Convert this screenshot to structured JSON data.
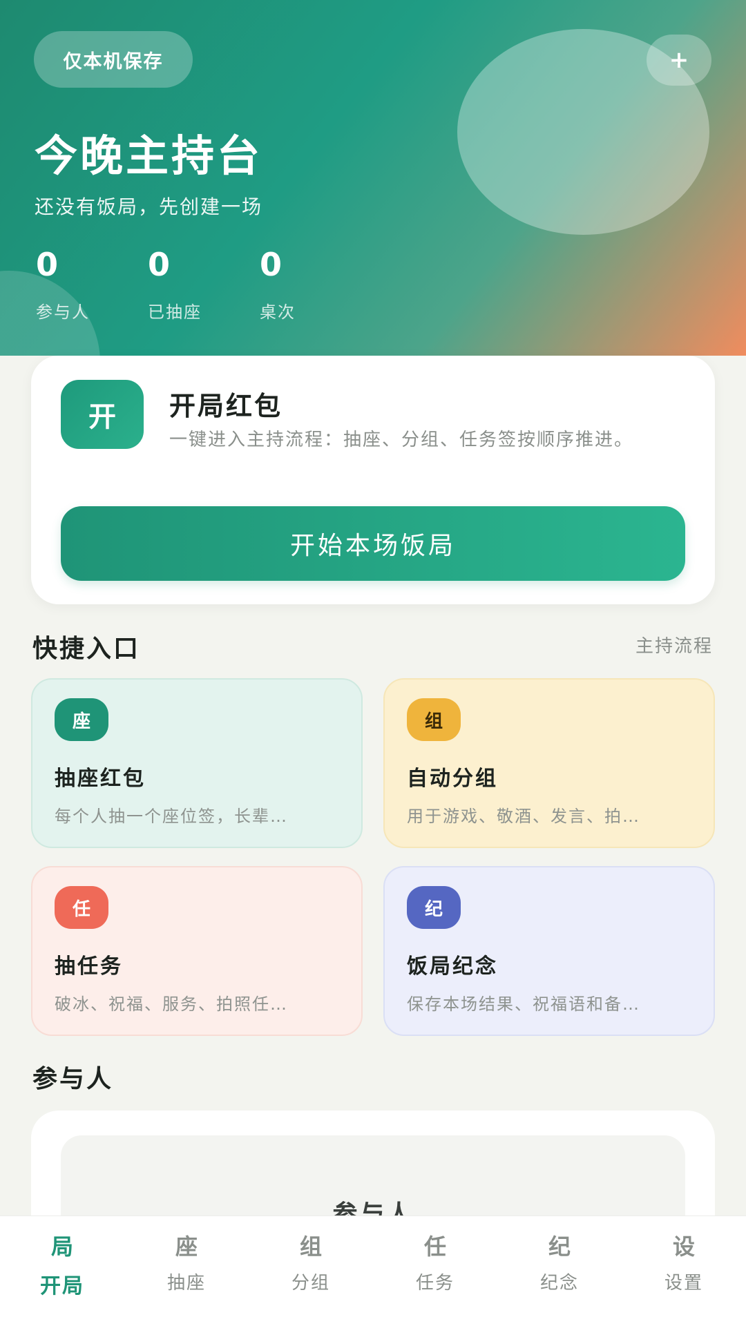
{
  "hero": {
    "badge": "仅本机保存",
    "add_icon": "+",
    "title": "今晚主持台",
    "subtitle": "还没有饭局，先创建一场",
    "stats": [
      {
        "value": "0",
        "label": "参与人"
      },
      {
        "value": "0",
        "label": "已抽座"
      },
      {
        "value": "0",
        "label": "桌次"
      }
    ]
  },
  "start_card": {
    "icon": "开",
    "title": "开局红包",
    "desc": "一键进入主持流程：抽座、分组、任务签按顺序推进。",
    "button": "开始本场饭局"
  },
  "quick": {
    "title": "快捷入口",
    "link": "主持流程",
    "tiles": [
      {
        "badge": "座",
        "title": "抽座红包",
        "desc": "每个人抽一个座位签，长辈…"
      },
      {
        "badge": "组",
        "title": "自动分组",
        "desc": "用于游戏、敬酒、发言、拍…"
      },
      {
        "badge": "任",
        "title": "抽任务",
        "desc": "破冰、祝福、服务、拍照任…"
      },
      {
        "badge": "纪",
        "title": "饭局纪念",
        "desc": "保存本场结果、祝福语和备…"
      }
    ]
  },
  "participants": {
    "title": "参与人",
    "inner_title": "参与人"
  },
  "nav": [
    {
      "glyph": "局",
      "label": "开局"
    },
    {
      "glyph": "座",
      "label": "抽座"
    },
    {
      "glyph": "组",
      "label": "分组"
    },
    {
      "glyph": "任",
      "label": "任务"
    },
    {
      "glyph": "纪",
      "label": "纪念"
    },
    {
      "glyph": "设",
      "label": "设置"
    }
  ],
  "colors": {
    "accent": "#1f9477",
    "tile_seat_bg": "#e3f3ee",
    "tile_group_bg": "#fcf0cf",
    "tile_task_bg": "#fdeeea",
    "tile_memo_bg": "#eceefb"
  }
}
